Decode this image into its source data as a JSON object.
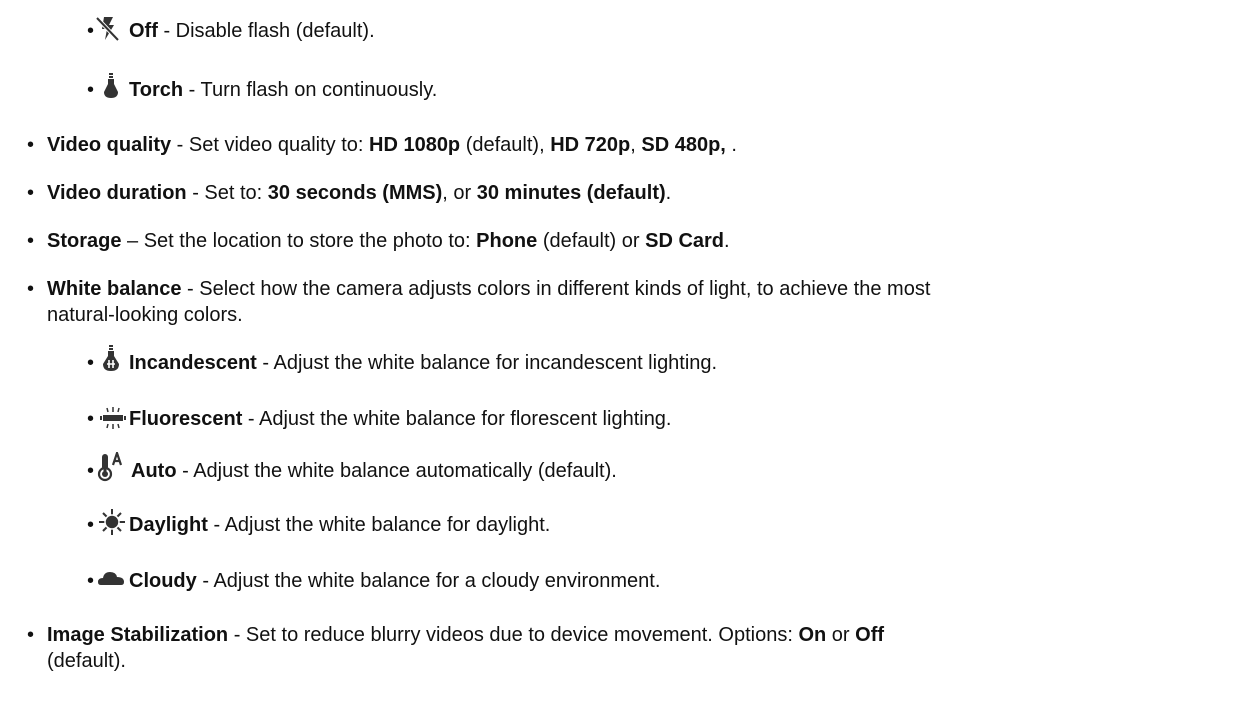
{
  "bullet_char": "•",
  "flash_items": [
    {
      "icon": "flash-off-icon",
      "term": "Off",
      "desc": " - Disable flash (default)."
    },
    {
      "icon": "torch-icon",
      "term": "Torch",
      "desc": " - Turn flash on continuously."
    }
  ],
  "video_quality": {
    "term": "Video quality",
    "pre": " - Set video quality to: ",
    "opt1": "HD 1080p",
    "mid1": " (default), ",
    "opt2": "HD 720p",
    "mid2": ", ",
    "opt3": "SD 480p,",
    "post": " ."
  },
  "video_duration": {
    "term": "Video duration",
    "pre": " - Set to: ",
    "opt1": "30 seconds (MMS)",
    "mid": ", or ",
    "opt2": "30 minutes (default)",
    "post": "."
  },
  "storage": {
    "term": "Storage",
    "pre": " – Set the location to store the photo to: ",
    "opt1": "Phone",
    "mid": " (default) or ",
    "opt2": "SD Card",
    "post": "."
  },
  "white_balance": {
    "term": "White balance",
    "line1": " - Select how the camera adjusts colors in different kinds of light, to achieve the most",
    "line2": "natural-looking colors."
  },
  "wb_items": [
    {
      "icon": "incandescent-icon",
      "term": "Incandescent",
      "desc": " - Adjust the white balance for incandescent lighting."
    },
    {
      "icon": "fluorescent-icon",
      "term": "Fluorescent",
      "desc": " - Adjust the white balance for florescent lighting."
    },
    {
      "icon": "auto-white-balance-icon",
      "term": "Auto",
      "desc": " - Adjust the white balance automatically (default)."
    },
    {
      "icon": "daylight-icon",
      "term": "Daylight",
      "desc": " - Adjust the white balance for daylight."
    },
    {
      "icon": "cloudy-icon",
      "term": "Cloudy",
      "desc": " - Adjust the white balance for a cloudy environment."
    }
  ],
  "image_stabilization": {
    "term": "Image Stabilization",
    "pre": " - Set to reduce blurry videos due to device movement. Options: ",
    "opt1": "On",
    "mid": " or ",
    "opt2": "Off",
    "line2": "(default)."
  }
}
